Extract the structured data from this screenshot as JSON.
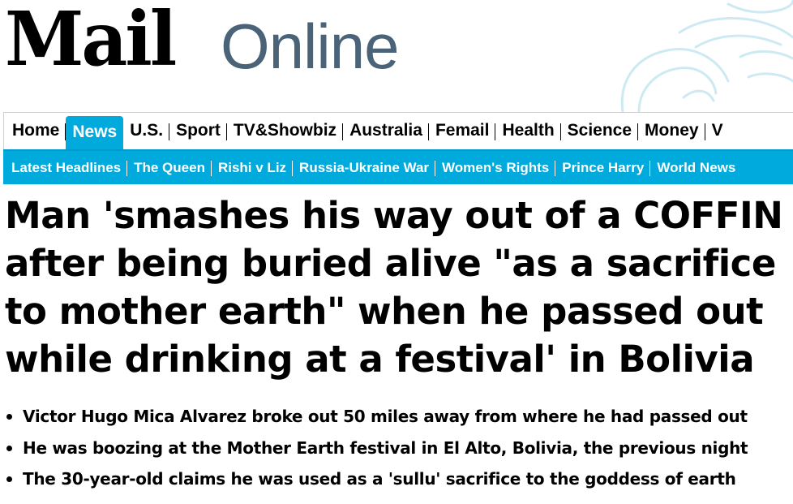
{
  "brand": {
    "logo_mail": "Mail",
    "logo_online": "Online",
    "online_color": "#4a6378"
  },
  "primary_nav": {
    "items": [
      {
        "label": "Home",
        "active": false
      },
      {
        "label": "News",
        "active": true
      },
      {
        "label": "U.S.",
        "active": false
      },
      {
        "label": "Sport",
        "active": false
      },
      {
        "label": "TV&Showbiz",
        "active": false
      },
      {
        "label": "Australia",
        "active": false
      },
      {
        "label": "Femail",
        "active": false
      },
      {
        "label": "Health",
        "active": false
      },
      {
        "label": "Science",
        "active": false
      },
      {
        "label": "Money",
        "active": false
      },
      {
        "label": "V",
        "active": false
      }
    ]
  },
  "secondary_nav": {
    "items": [
      {
        "label": "Latest Headlines"
      },
      {
        "label": "The Queen"
      },
      {
        "label": "Rishi v Liz"
      },
      {
        "label": "Russia-Ukraine War"
      },
      {
        "label": "Women's Rights"
      },
      {
        "label": "Prince Harry"
      },
      {
        "label": "World News"
      }
    ]
  },
  "article": {
    "headline": "Man 'smashes his way out of a COFFIN after being buried alive \"as a sacrifice to mother earth\" when he passed out while drinking at a festival' in Bolivia",
    "bullets": [
      "Victor Hugo Mica Alvarez broke out 50 miles away from where he had passed out",
      "He was boozing at the Mother Earth festival in El Alto, Bolivia, the previous night",
      "The 30-year-old claims he was used as a 'sullu' sacrifice to the goddess of earth"
    ]
  },
  "colors": {
    "accent": "#00aadd",
    "text": "#000000",
    "background": "#ffffff",
    "decoration": "#cdeaf3"
  },
  "icons": {
    "masthead_decoration": "swirl-decoration-icon"
  }
}
